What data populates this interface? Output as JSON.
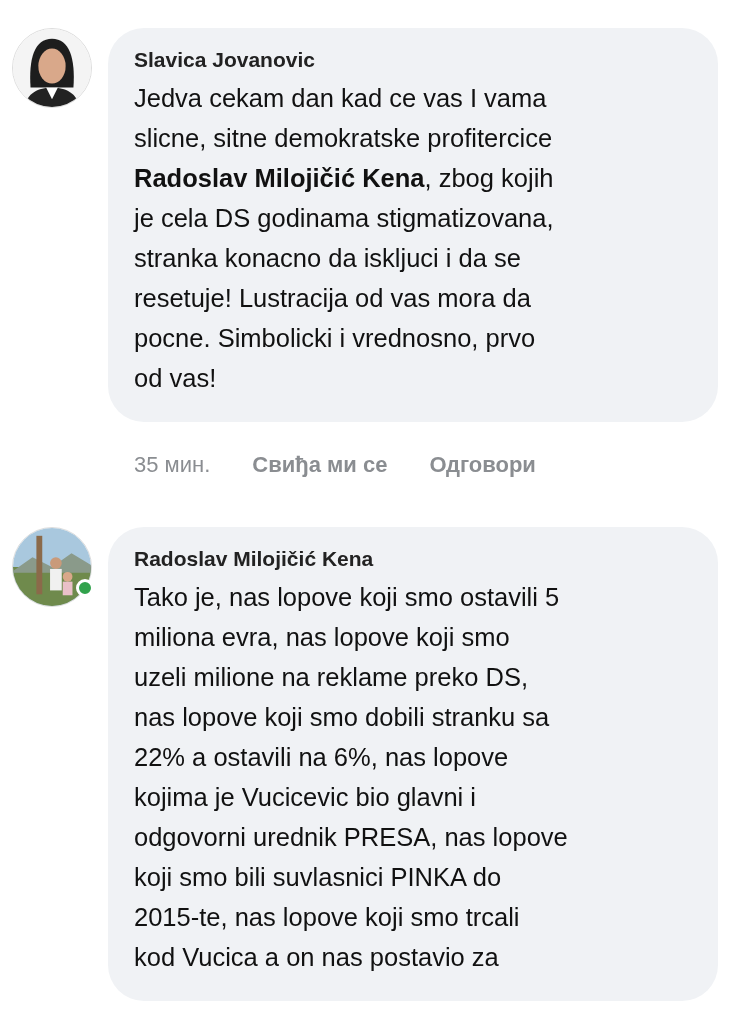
{
  "comments": [
    {
      "author": "Slavica Jovanovic",
      "online": false,
      "text": "Jedva cekam dan kad ce vas I vama\nslicne, sitne demokratske profitercice\n**Radoslav Milojičić Kena**, zbog kojih\nje cela DS godinama stigmatizovana,\nstranka konacno da iskljuci i da se\nresetuje! Lustracija od vas mora da\npocne. Simbolicki i vrednosno, prvo\nod vas!",
      "time": "35 мин.",
      "actions": [
        "Свиђа ми се",
        "Одговори"
      ]
    },
    {
      "author": "Radoslav Milojičić Kena",
      "online": true,
      "text": "Tako je, nas lopove koji smo ostavili 5\nmiliona evra, nas lopove koji smo\nuzeli milione na reklame preko DS,\nnas lopove koji smo dobili stranku sa\n22% a ostavili na 6%, nas lopove\nkojima je Vucicevic bio glavni i\nodgovorni urednik PRESA, nas lopove\nkoji smo bili suvlasnici PINKA do\n2015-te, nas lopove koji smo trcali\nkod Vucica a on nas postavio za"
    }
  ]
}
